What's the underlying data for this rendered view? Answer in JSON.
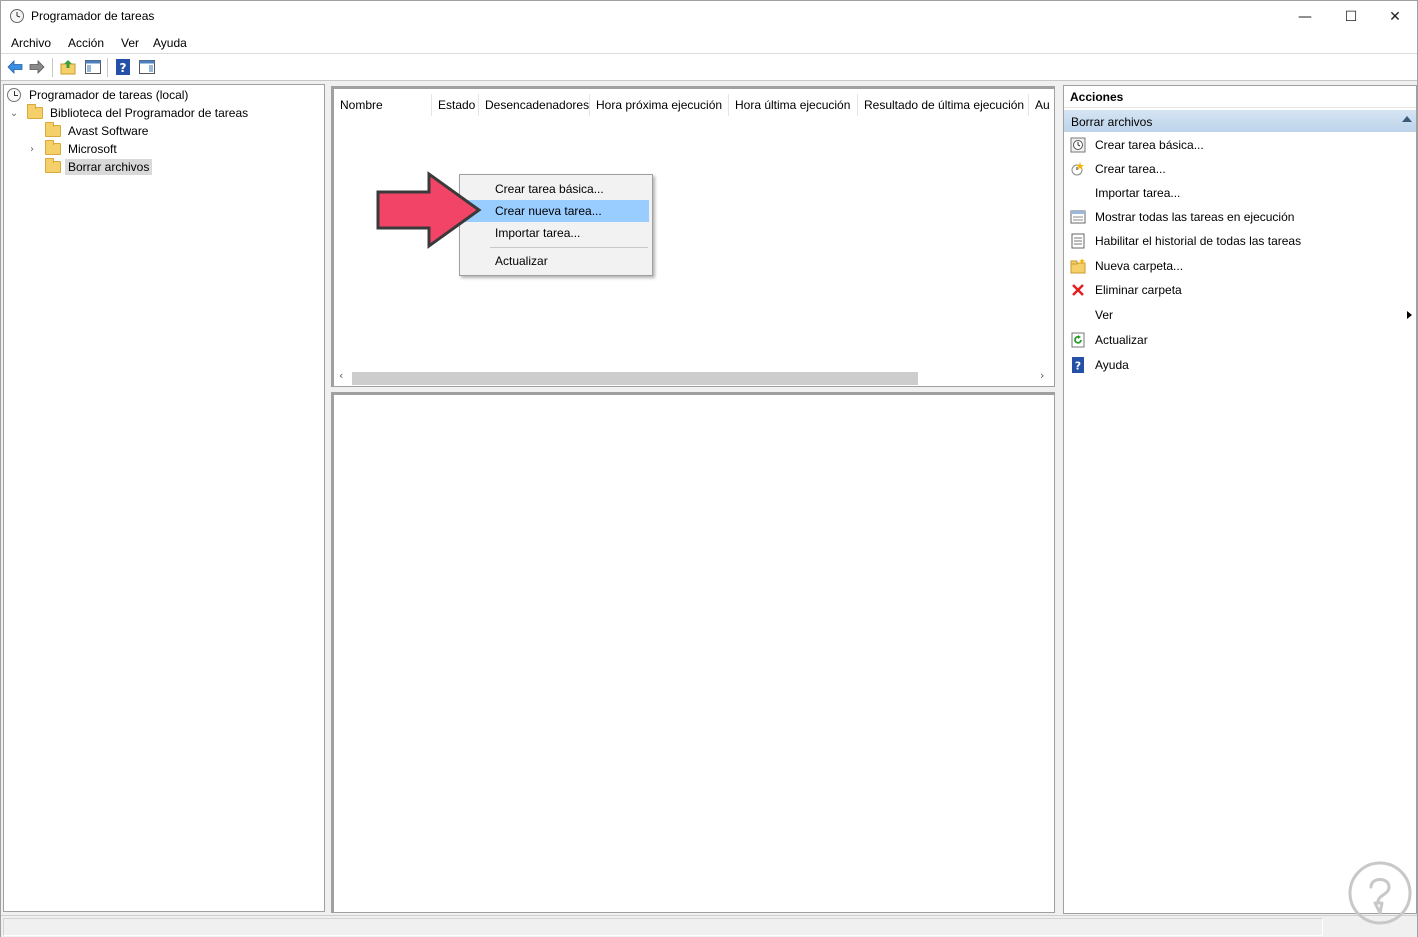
{
  "window": {
    "title": "Programador de tareas",
    "min_glyph": "—",
    "max_glyph": "☐",
    "close_glyph": "✕"
  },
  "menubar": {
    "items": [
      "Archivo",
      "Acción",
      "Ver",
      "Ayuda"
    ]
  },
  "toolbar": {
    "buttons": [
      "back-icon",
      "forward-icon",
      "folder-up-icon",
      "show-hide-console-tree-icon",
      "help-icon",
      "show-hide-action-pane-icon"
    ]
  },
  "tree": {
    "root": "Programador de tareas (local)",
    "library": "Biblioteca del Programador de tareas",
    "children": [
      {
        "label": "Avast Software"
      },
      {
        "label": "Microsoft"
      },
      {
        "label": "Borrar archivos"
      }
    ],
    "expand_glyph": "⌄",
    "collapsed_glyph": "›"
  },
  "task_list": {
    "columns": [
      "Nombre",
      "Estado",
      "Desencadenadores",
      "Hora próxima ejecución",
      "Hora última ejecución",
      "Resultado de última ejecución",
      "Au"
    ],
    "scroll_left": "‹",
    "scroll_right": "›"
  },
  "context_menu": {
    "items": [
      "Crear tarea básica...",
      "Crear nueva tarea...",
      "Importar tarea...",
      "Actualizar"
    ],
    "highlighted": "Crear nueva tarea..."
  },
  "actions": {
    "header": "Acciones",
    "section": "Borrar archivos",
    "items": [
      {
        "label": "Crear tarea básica...",
        "icon": "create-basic-task-icon"
      },
      {
        "label": "Crear tarea...",
        "icon": "create-task-icon"
      },
      {
        "label": "Importar tarea...",
        "icon": ""
      },
      {
        "label": "Mostrar todas las tareas en ejecución",
        "icon": "running-tasks-icon"
      },
      {
        "label": "Habilitar el historial de todas las tareas",
        "icon": "history-icon"
      },
      {
        "label": "Nueva carpeta...",
        "icon": "new-folder-icon"
      },
      {
        "label": "Eliminar carpeta",
        "icon": "delete-icon"
      },
      {
        "label": "Ver",
        "icon": ""
      },
      {
        "label": "Actualizar",
        "icon": "refresh-icon"
      },
      {
        "label": "Ayuda",
        "icon": "help-icon"
      }
    ]
  },
  "colors": {
    "highlight": "#99ccff",
    "section_header": "#c5daef",
    "arrow_fill": "#f24466",
    "delete_red": "#e02020"
  }
}
